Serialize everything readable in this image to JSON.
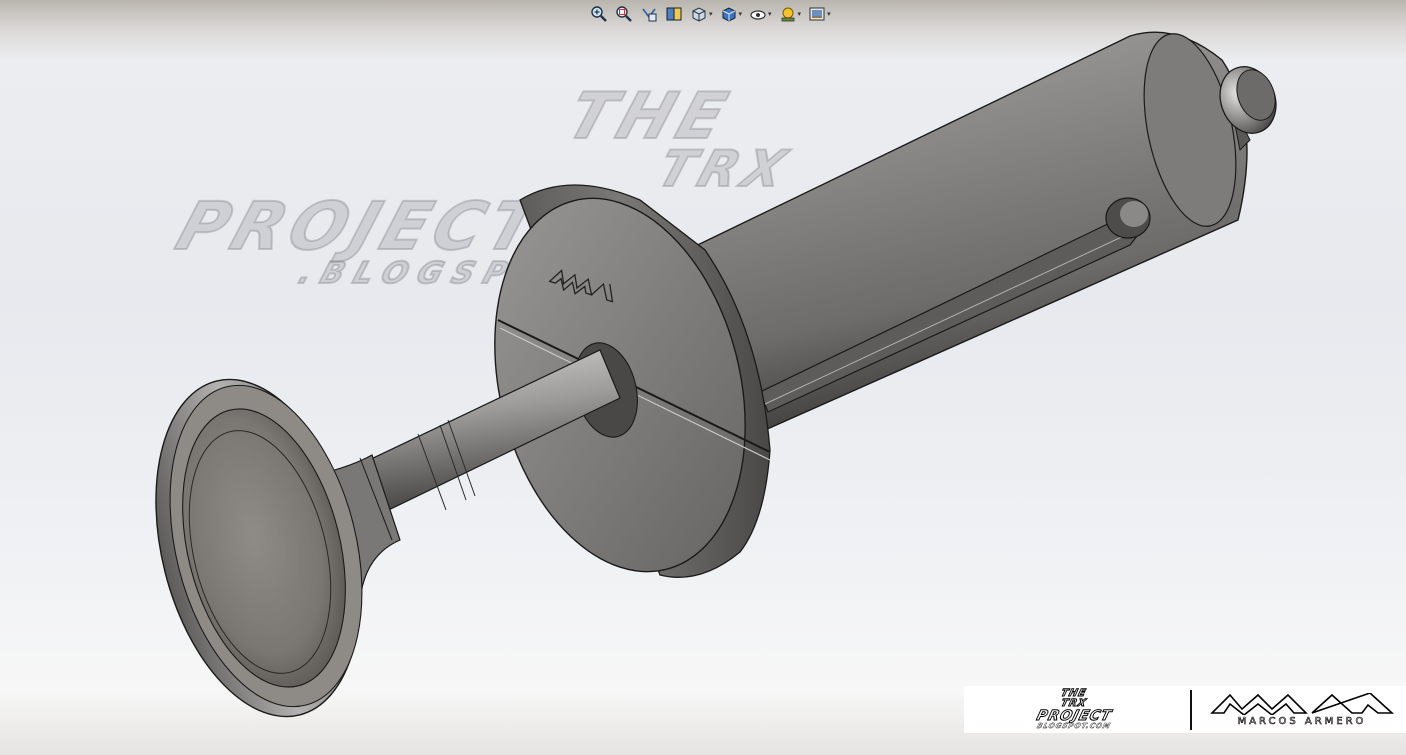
{
  "toolbar": {
    "buttons": [
      {
        "id": "zoom-to-fit",
        "icon": "zoom-to-fit-icon",
        "has_dropdown": false
      },
      {
        "id": "zoom-to-area",
        "icon": "zoom-to-area-icon",
        "has_dropdown": false
      },
      {
        "id": "previous-view",
        "icon": "previous-view-icon",
        "has_dropdown": false
      },
      {
        "id": "section-view",
        "icon": "section-view-icon",
        "has_dropdown": false
      },
      {
        "id": "view-orientation",
        "icon": "view-orientation-icon",
        "has_dropdown": true
      },
      {
        "id": "display-style",
        "icon": "display-style-icon",
        "has_dropdown": true
      },
      {
        "id": "hide-show-items",
        "icon": "hide-show-items-icon",
        "has_dropdown": true
      },
      {
        "id": "edit-appearance",
        "icon": "edit-appearance-icon",
        "has_dropdown": true
      },
      {
        "id": "apply-scene",
        "icon": "apply-scene-icon",
        "has_dropdown": true
      }
    ],
    "caret_glyph": "▾"
  },
  "watermark": {
    "line1": "THE",
    "line2": "TRX",
    "line3": "PROJECT",
    "line4": ".BLOGSPOT.COM"
  },
  "model": {
    "engraved_logo": "MA logo"
  },
  "logo": {
    "trx_line1": "THE",
    "trx_line2": "TRX",
    "trx_line3": "PROJECT",
    "trx_line4": "BLOGSPOT.COM",
    "ma_name": "MARCOS ARMERO"
  },
  "colors": {
    "metal_light": "#b8b6b4",
    "metal_mid": "#8e8c8a",
    "metal_dark": "#4a4847",
    "edge": "#1a1a1a"
  }
}
